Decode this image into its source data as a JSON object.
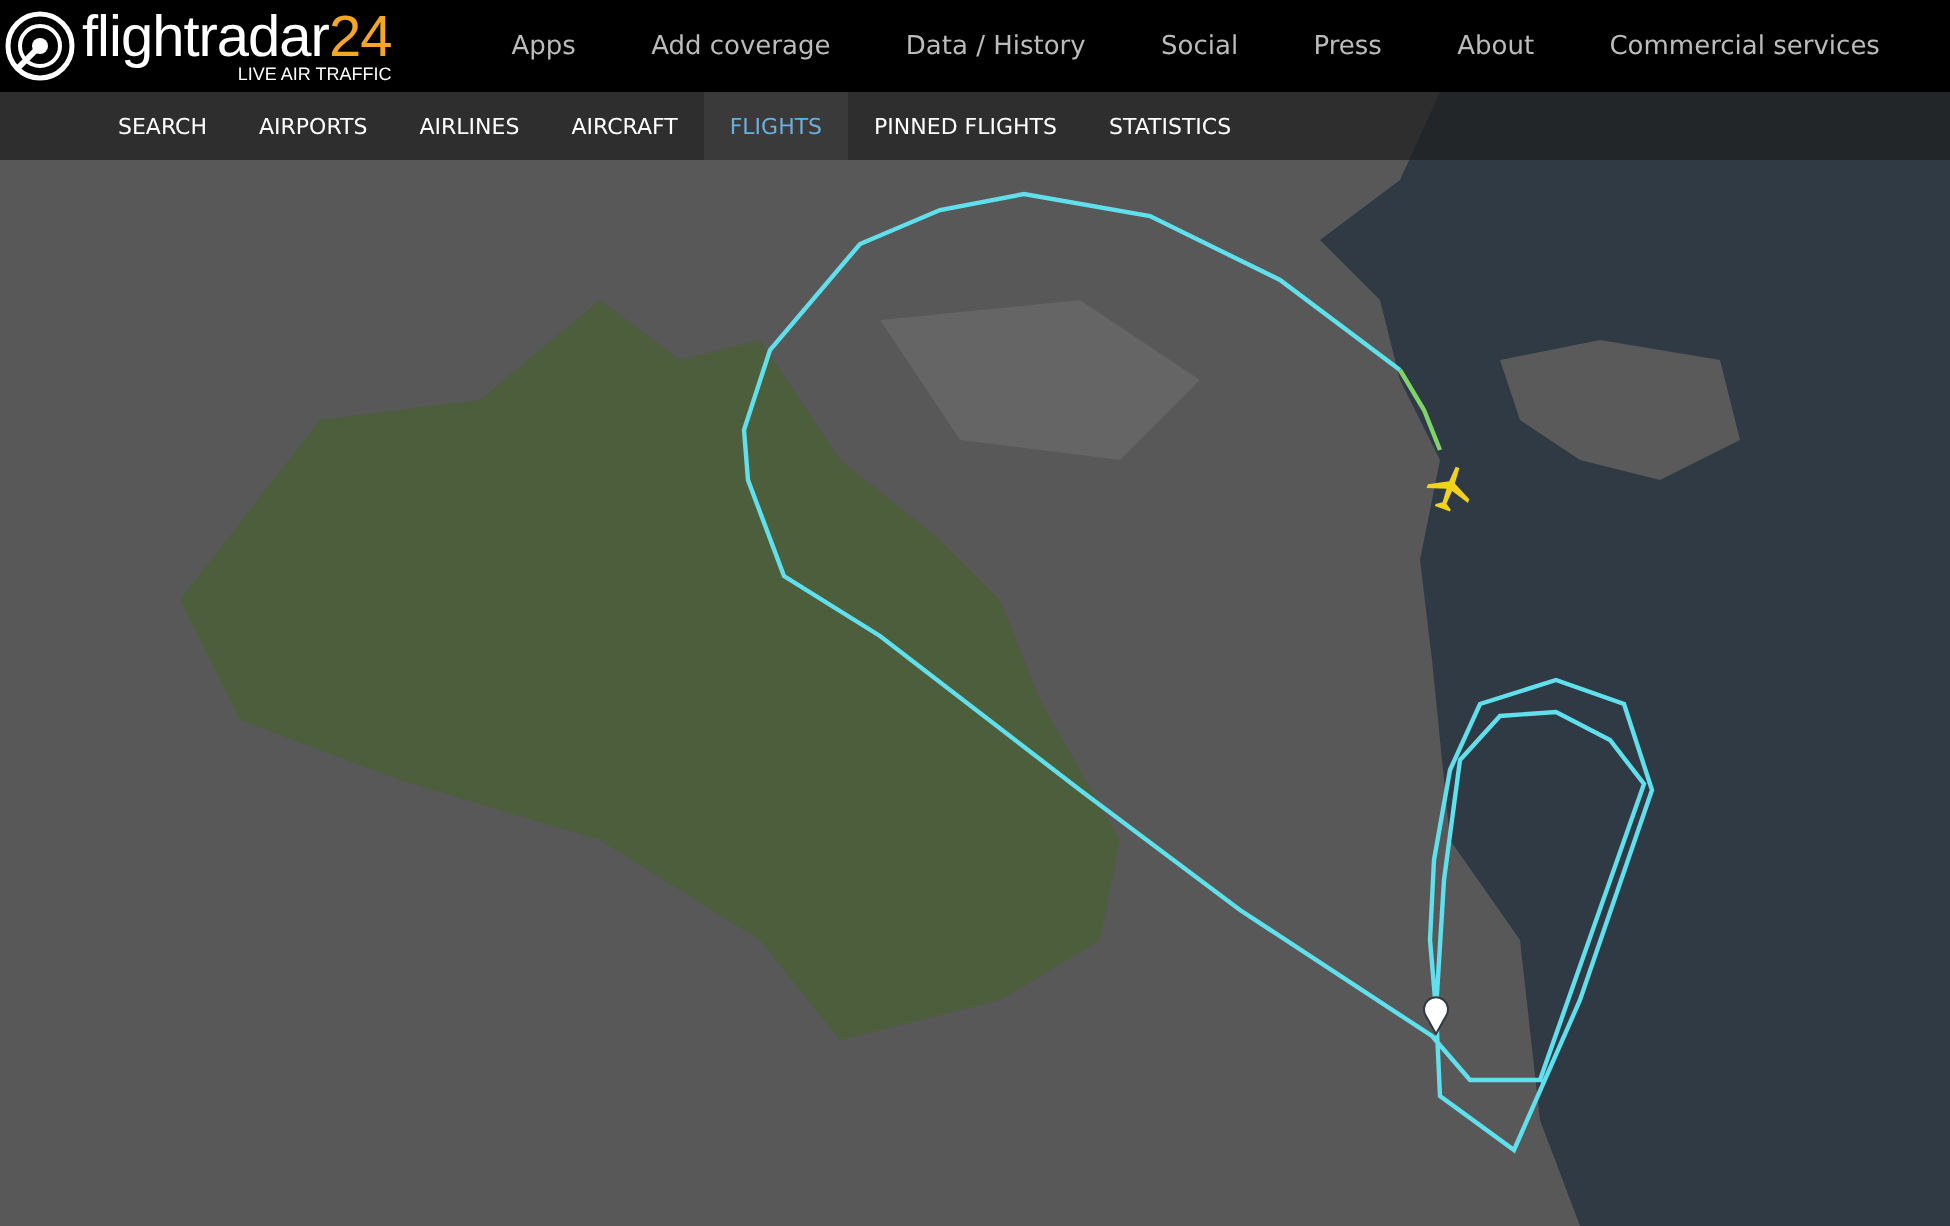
{
  "logo": {
    "name": "flightradar",
    "number": "24",
    "tagline": "LIVE AIR TRAFFIC"
  },
  "top_nav": [
    "Apps",
    "Add coverage",
    "Data / History",
    "Social",
    "Press",
    "About",
    "Commercial services"
  ],
  "sub_nav": [
    {
      "label": "SEARCH",
      "selected": false
    },
    {
      "label": "AIRPORTS",
      "selected": false
    },
    {
      "label": "AIRLINES",
      "selected": false
    },
    {
      "label": "AIRCRAFT",
      "selected": false
    },
    {
      "label": "FLIGHTS",
      "selected": true
    },
    {
      "label": "PINNED FLIGHTS",
      "selected": false
    },
    {
      "label": "STATISTICS",
      "selected": false
    }
  ]
}
